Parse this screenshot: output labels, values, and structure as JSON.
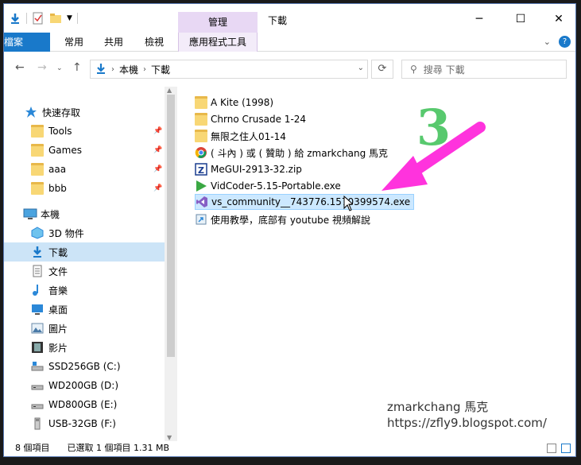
{
  "window": {
    "title": "下載",
    "manage_tab": "管理"
  },
  "ribbon": {
    "tabs": [
      "檔案",
      "常用",
      "共用",
      "檢視"
    ],
    "context_tab": "應用程式工具"
  },
  "address": {
    "path": [
      "本機",
      "下載"
    ],
    "search_placeholder": "搜尋 下載"
  },
  "nav": {
    "quick_access": "快速存取",
    "pinned": [
      "Tools",
      "Games",
      "aaa",
      "bbb"
    ],
    "this_pc": "本機",
    "pc_items": [
      "3D 物件",
      "下載",
      "文件",
      "音樂",
      "桌面",
      "圖片",
      "影片"
    ],
    "drives": [
      "SSD256GB (C:)",
      "WD200GB (D:)",
      "WD800GB (E:)",
      "USB-32GB (F:)"
    ]
  },
  "files": [
    {
      "name": "A Kite (1998)",
      "icon": "folder-icon"
    },
    {
      "name": "Chrno Crusade 1-24",
      "icon": "folder-icon"
    },
    {
      "name": "無限之住人01-14",
      "icon": "folder-icon"
    },
    {
      "name": "( 斗內 ) 或 ( 贊助 ) 給 zmarkchang 馬克",
      "icon": "chrome-link-icon"
    },
    {
      "name": "MeGUI-2913-32.zip",
      "icon": "zip-icon"
    },
    {
      "name": "VidCoder-5.15-Portable.exe",
      "icon": "vidcoder-icon"
    },
    {
      "name": "vs_community__743776.1570399574.exe",
      "icon": "visual-studio-icon",
      "selected": true
    },
    {
      "name": "使用教學，底部有 youtube 視頻解說",
      "icon": "shortcut-icon"
    }
  ],
  "status": {
    "count": "8 個項目",
    "selection": "已選取 1 個項目  1.31 MB"
  },
  "annotation": {
    "number": "3",
    "arrow_color": "#ff33dd",
    "number_color": "#58c96e"
  },
  "watermark": {
    "line1": "zmarkchang 馬克",
    "line2": "https://zfly9.blogspot.com/"
  },
  "colors": {
    "accent": "#1979ca",
    "selection": "#cce8ff",
    "context_tab": "#e8d8f4"
  }
}
